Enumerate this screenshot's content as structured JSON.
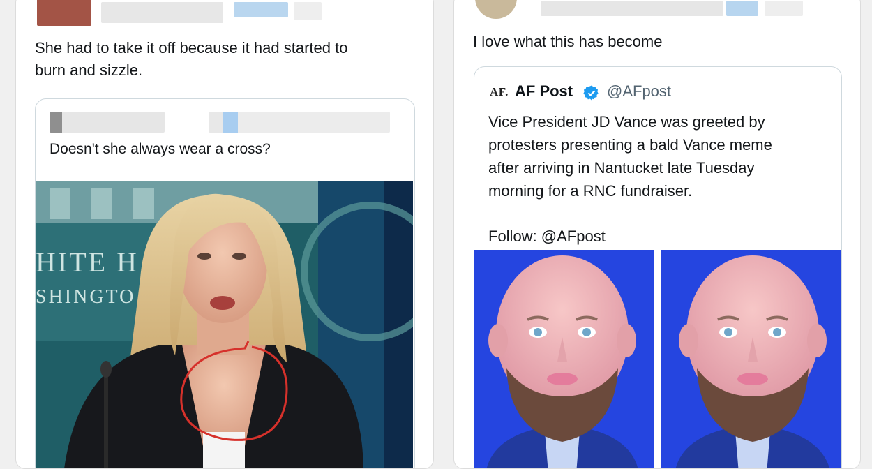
{
  "left_post": {
    "text": "She had to take it off because it had started to\nburn and sizzle.",
    "quote": {
      "text": "Doesn't she always wear a cross?",
      "image_wall_text_1": "HITE H",
      "image_wall_text_2": "SHINGTO"
    }
  },
  "right_post": {
    "text": "I love what this has become",
    "quote": {
      "logo": "AF.",
      "name": "AF Post",
      "handle": "@AFpost",
      "text": "Vice President JD Vance was greeted by\nprotesters presenting a bald Vance meme\nafter arriving in Nantucket late Tuesday\nmorning for a RNC fundraiser.",
      "follow": "Follow: @AFpost"
    }
  },
  "colors": {
    "verified_blue": "#1d9bf0",
    "annotation_red": "#d6312b",
    "meme_background": "#2545e0"
  }
}
